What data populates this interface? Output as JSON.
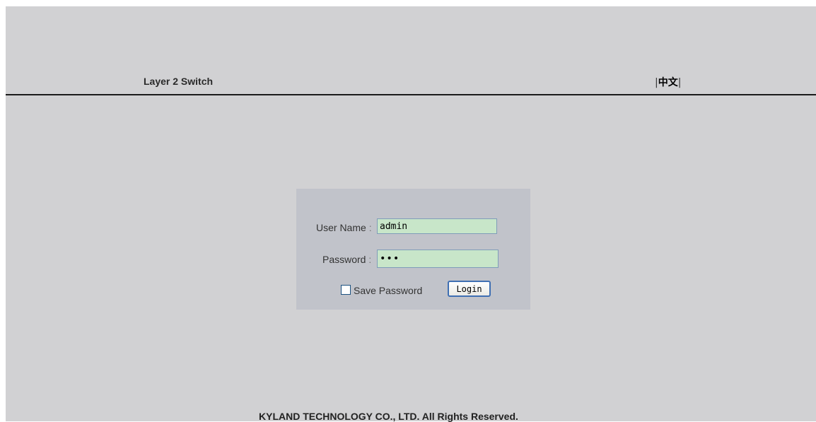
{
  "header": {
    "product_title": "Layer 2 Switch",
    "language_link": "中文",
    "language_prefix": "|",
    "language_suffix": "|"
  },
  "login": {
    "username_label": "User Name",
    "username_value": "admin",
    "password_label": "Password",
    "password_value": "adm",
    "save_password_label": "Save Password",
    "save_password_checked": false,
    "login_button_label": "Login",
    "label_separator": ":"
  },
  "footer": {
    "copyright": "KYLAND TECHNOLOGY CO., LTD. All Rights Reserved."
  },
  "colors": {
    "page_background": "#d1d1d3",
    "login_box_background": "#c1c3ca",
    "input_background": "#c8e6c9",
    "divider": "#1a1a1a"
  }
}
